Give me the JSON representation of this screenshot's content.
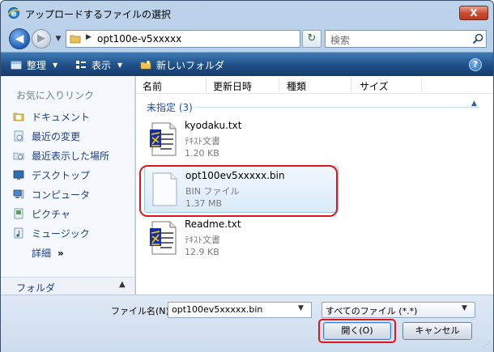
{
  "window": {
    "title": "アップロードするファイルの選択",
    "close_label": "X"
  },
  "address": {
    "path": "opt100e-v5xxxxx",
    "search_placeholder": "検索"
  },
  "toolbar": {
    "organize_label": "整理",
    "views_label": "表示",
    "new_folder_label": "新しいフォルダ",
    "help_label": "?"
  },
  "sidebar": {
    "header": "お気に入りリンク",
    "items": [
      {
        "label": "ドキュメント",
        "icon": "documents-folder-icon"
      },
      {
        "label": "最近の変更",
        "icon": "recent-changes-icon"
      },
      {
        "label": "最近表示した場所",
        "icon": "recent-places-icon"
      },
      {
        "label": "デスクトップ",
        "icon": "desktop-icon"
      },
      {
        "label": "コンピュータ",
        "icon": "computer-icon"
      },
      {
        "label": "ピクチャ",
        "icon": "pictures-icon"
      },
      {
        "label": "ミュージック",
        "icon": "music-icon"
      }
    ],
    "more_label": "詳細",
    "more_arrows": "»",
    "folders_label": "フォルダ"
  },
  "columns": [
    "名前",
    "更新日時",
    "種類",
    "サイズ"
  ],
  "group": {
    "label": "未指定 (3)"
  },
  "files": [
    {
      "name": "kyodaku.txt",
      "type": "ﾃｷｽﾄ文書",
      "size": "1.20 KB",
      "icon": "text-document-icon",
      "selected": false
    },
    {
      "name": "opt100ev5xxxxx.bin",
      "type": "BIN ファイル",
      "size": "1.37 MB",
      "icon": "blank-file-icon",
      "selected": true
    },
    {
      "name": "Readme.txt",
      "type": "ﾃｷｽﾄ文書",
      "size": "12.9 KB",
      "icon": "text-document-icon",
      "selected": false
    }
  ],
  "footer": {
    "filename_label": "ファイル名(N):",
    "filename_value": "opt100ev5xxxxx.bin",
    "filetype_value": "すべてのファイル (*.*)",
    "open_label": "開く(O)",
    "cancel_label": "キャンセル"
  },
  "colors": {
    "highlight_red": "#e0161c",
    "toolbar_blue": "#1f4e87",
    "link_blue": "#1a3f8a"
  }
}
